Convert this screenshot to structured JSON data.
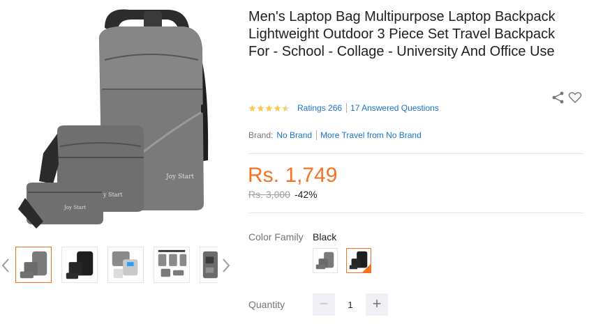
{
  "product": {
    "title": "Men's Laptop Bag Multipurpose Laptop Backpack Lightweight Outdoor 3 Piece Set Travel Backpack For - School - Collage - University And Office Use",
    "rating_value": 4.5,
    "ratings_text": "Ratings 266",
    "questions_text": "17 Answered Questions",
    "brand_label": "Brand:",
    "brand_name": "No Brand",
    "more_from": "More Travel from No Brand",
    "price": "Rs. 1,749",
    "original_price": "Rs. 3,000",
    "discount": "-42%",
    "main_image_print": "Joy Start"
  },
  "gallery": {
    "thumbnails": [
      {
        "name": "grey-set",
        "active": true
      },
      {
        "name": "black-set",
        "active": false
      },
      {
        "name": "usb-feature",
        "active": false
      },
      {
        "name": "dimensions",
        "active": false
      },
      {
        "name": "detail",
        "active": false
      }
    ]
  },
  "variant": {
    "label": "Color Family",
    "selected": "Black",
    "swatches": [
      {
        "name": "grey",
        "active": false
      },
      {
        "name": "black",
        "active": true
      }
    ]
  },
  "quantity": {
    "label": "Quantity",
    "value": "1",
    "minus": "−",
    "plus": "+"
  },
  "colors": {
    "accent": "#f57224",
    "link": "#1a73c8",
    "star": "#faca51",
    "bag_grey": "#6b6b6b"
  },
  "icons": [
    "share-icon",
    "heart-icon",
    "chevron-left-icon",
    "chevron-right-icon",
    "star-icon"
  ]
}
